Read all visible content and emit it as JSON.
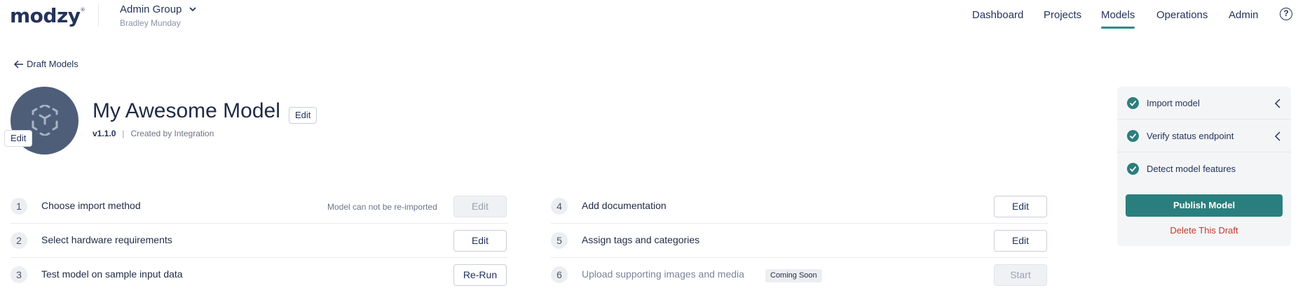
{
  "header": {
    "logo_text": "modzy",
    "logo_mark": "®",
    "group_name": "Admin Group",
    "user_name": "Bradley Munday",
    "nav": [
      {
        "label": "Dashboard"
      },
      {
        "label": "Projects"
      },
      {
        "label": "Models",
        "active": true
      },
      {
        "label": "Operations"
      },
      {
        "label": "Admin"
      }
    ],
    "help_glyph": "?"
  },
  "breadcrumb": {
    "back_label": "Draft Models"
  },
  "model": {
    "title": "My Awesome Model",
    "title_edit_label": "Edit",
    "avatar_edit_label": "Edit",
    "version": "v1.1.0",
    "separator": "|",
    "created_by": "Created by Integration"
  },
  "steps_left": [
    {
      "number": "1",
      "label": "Choose import method",
      "note": "Model can not be re-imported",
      "button": "Edit",
      "button_disabled": true
    },
    {
      "number": "2",
      "label": "Select hardware requirements",
      "note": "",
      "button": "Edit",
      "button_disabled": false
    },
    {
      "number": "3",
      "label": "Test model on sample input data",
      "note": "",
      "button": "Re-Run",
      "button_disabled": false
    }
  ],
  "steps_right": [
    {
      "number": "4",
      "label": "Add documentation",
      "badge": "",
      "button": "Edit",
      "button_disabled": false
    },
    {
      "number": "5",
      "label": "Assign tags and categories",
      "badge": "",
      "button": "Edit",
      "button_disabled": false
    },
    {
      "number": "6",
      "label": "Upload supporting images and media",
      "badge": "Coming Soon",
      "button": "Start",
      "button_disabled": true
    }
  ],
  "progress_panel": {
    "items": [
      {
        "label": "Import model",
        "status": "complete",
        "expandable": true
      },
      {
        "label": "Verify status endpoint",
        "status": "complete",
        "expandable": true
      },
      {
        "label": "Detect model features",
        "status": "complete",
        "expandable": false
      }
    ],
    "publish_label": "Publish Model",
    "delete_label": "Delete This Draft"
  },
  "colors": {
    "accent": "#2a7f7e",
    "text": "#1f2a44",
    "danger": "#c0392b",
    "avatar": "#4e5e78"
  },
  "icons": {
    "help": "help-circle-icon",
    "back": "arrow-left-icon",
    "group_dropdown": "chevron-down-icon",
    "model_avatar": "model-cube-icon",
    "check": "check-circle-icon",
    "panel_expand": "chevron-left-icon"
  }
}
